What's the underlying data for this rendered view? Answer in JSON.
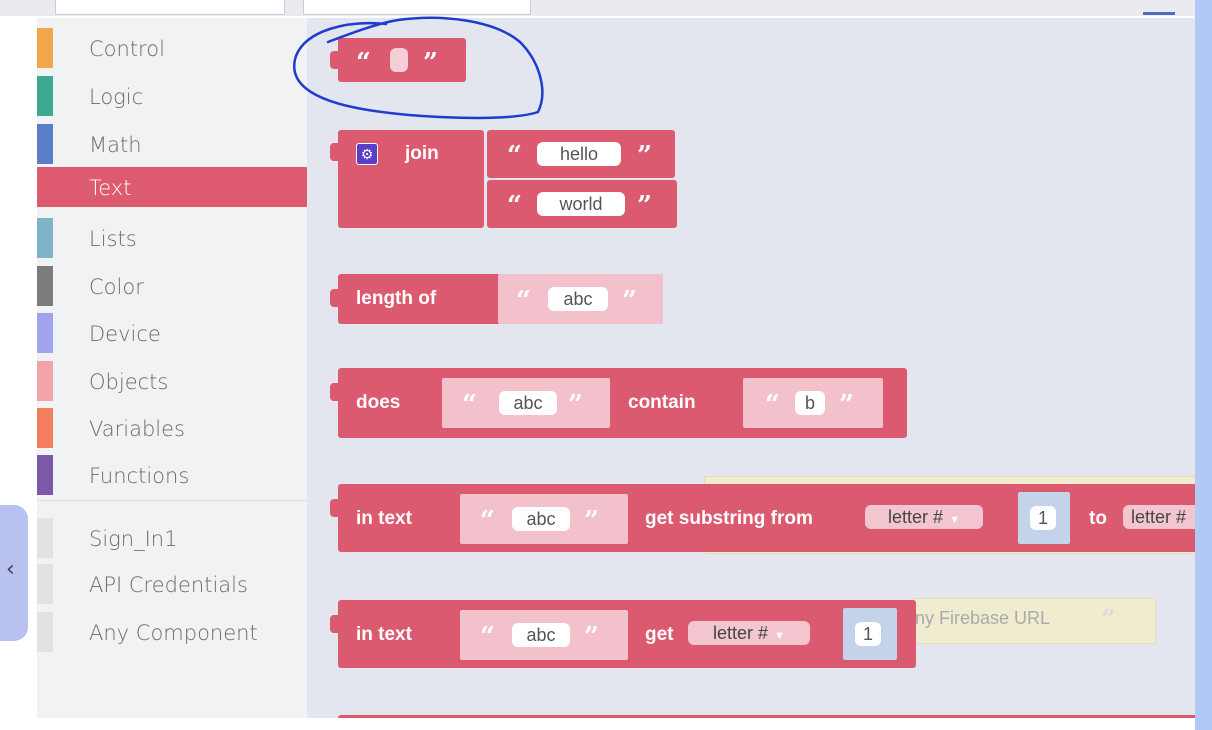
{
  "toolbox": {
    "categories": [
      {
        "label": "Control",
        "color": "#f3a54a"
      },
      {
        "label": "Logic",
        "color": "#3ea98f"
      },
      {
        "label": "Math",
        "color": "#5b7ec9"
      },
      {
        "label": "Text",
        "color": "#dd5a6f",
        "selected": true
      },
      {
        "label": "Lists",
        "color": "#7fb3c9"
      },
      {
        "label": "Color",
        "color": "#7c7c7c"
      },
      {
        "label": "Device",
        "color": "#9fa4ed"
      },
      {
        "label": "Objects",
        "color": "#f4a3a8"
      },
      {
        "label": "Variables",
        "color": "#f47d5e"
      },
      {
        "label": "Functions",
        "color": "#7a59a8"
      }
    ],
    "components": [
      {
        "label": "Sign_In1"
      },
      {
        "label": "API Credentials"
      },
      {
        "label": "Any Component"
      }
    ]
  },
  "blocks": {
    "join": {
      "label": "join",
      "item1": "hello",
      "item2": "world"
    },
    "length": {
      "label": "length of",
      "value": "abc"
    },
    "contains": {
      "label1": "does",
      "value": "abc",
      "label2": "contain",
      "search": "b"
    },
    "substring": {
      "label1": "in text",
      "value": "abc",
      "label2": "get substring from",
      "mode": "letter #",
      "index": "1",
      "label3": "to",
      "mode2": "letter #"
    },
    "get_letter": {
      "label1": "in text",
      "value": "abc",
      "label2": "get",
      "mode": "letter #",
      "index": "1"
    }
  },
  "background": {
    "ghost_text": "ny Firebase URL"
  },
  "colors": {
    "text_block": "#dc5a6f",
    "workspace": "#e4e6ef",
    "annotation": "#1f3bd0"
  }
}
